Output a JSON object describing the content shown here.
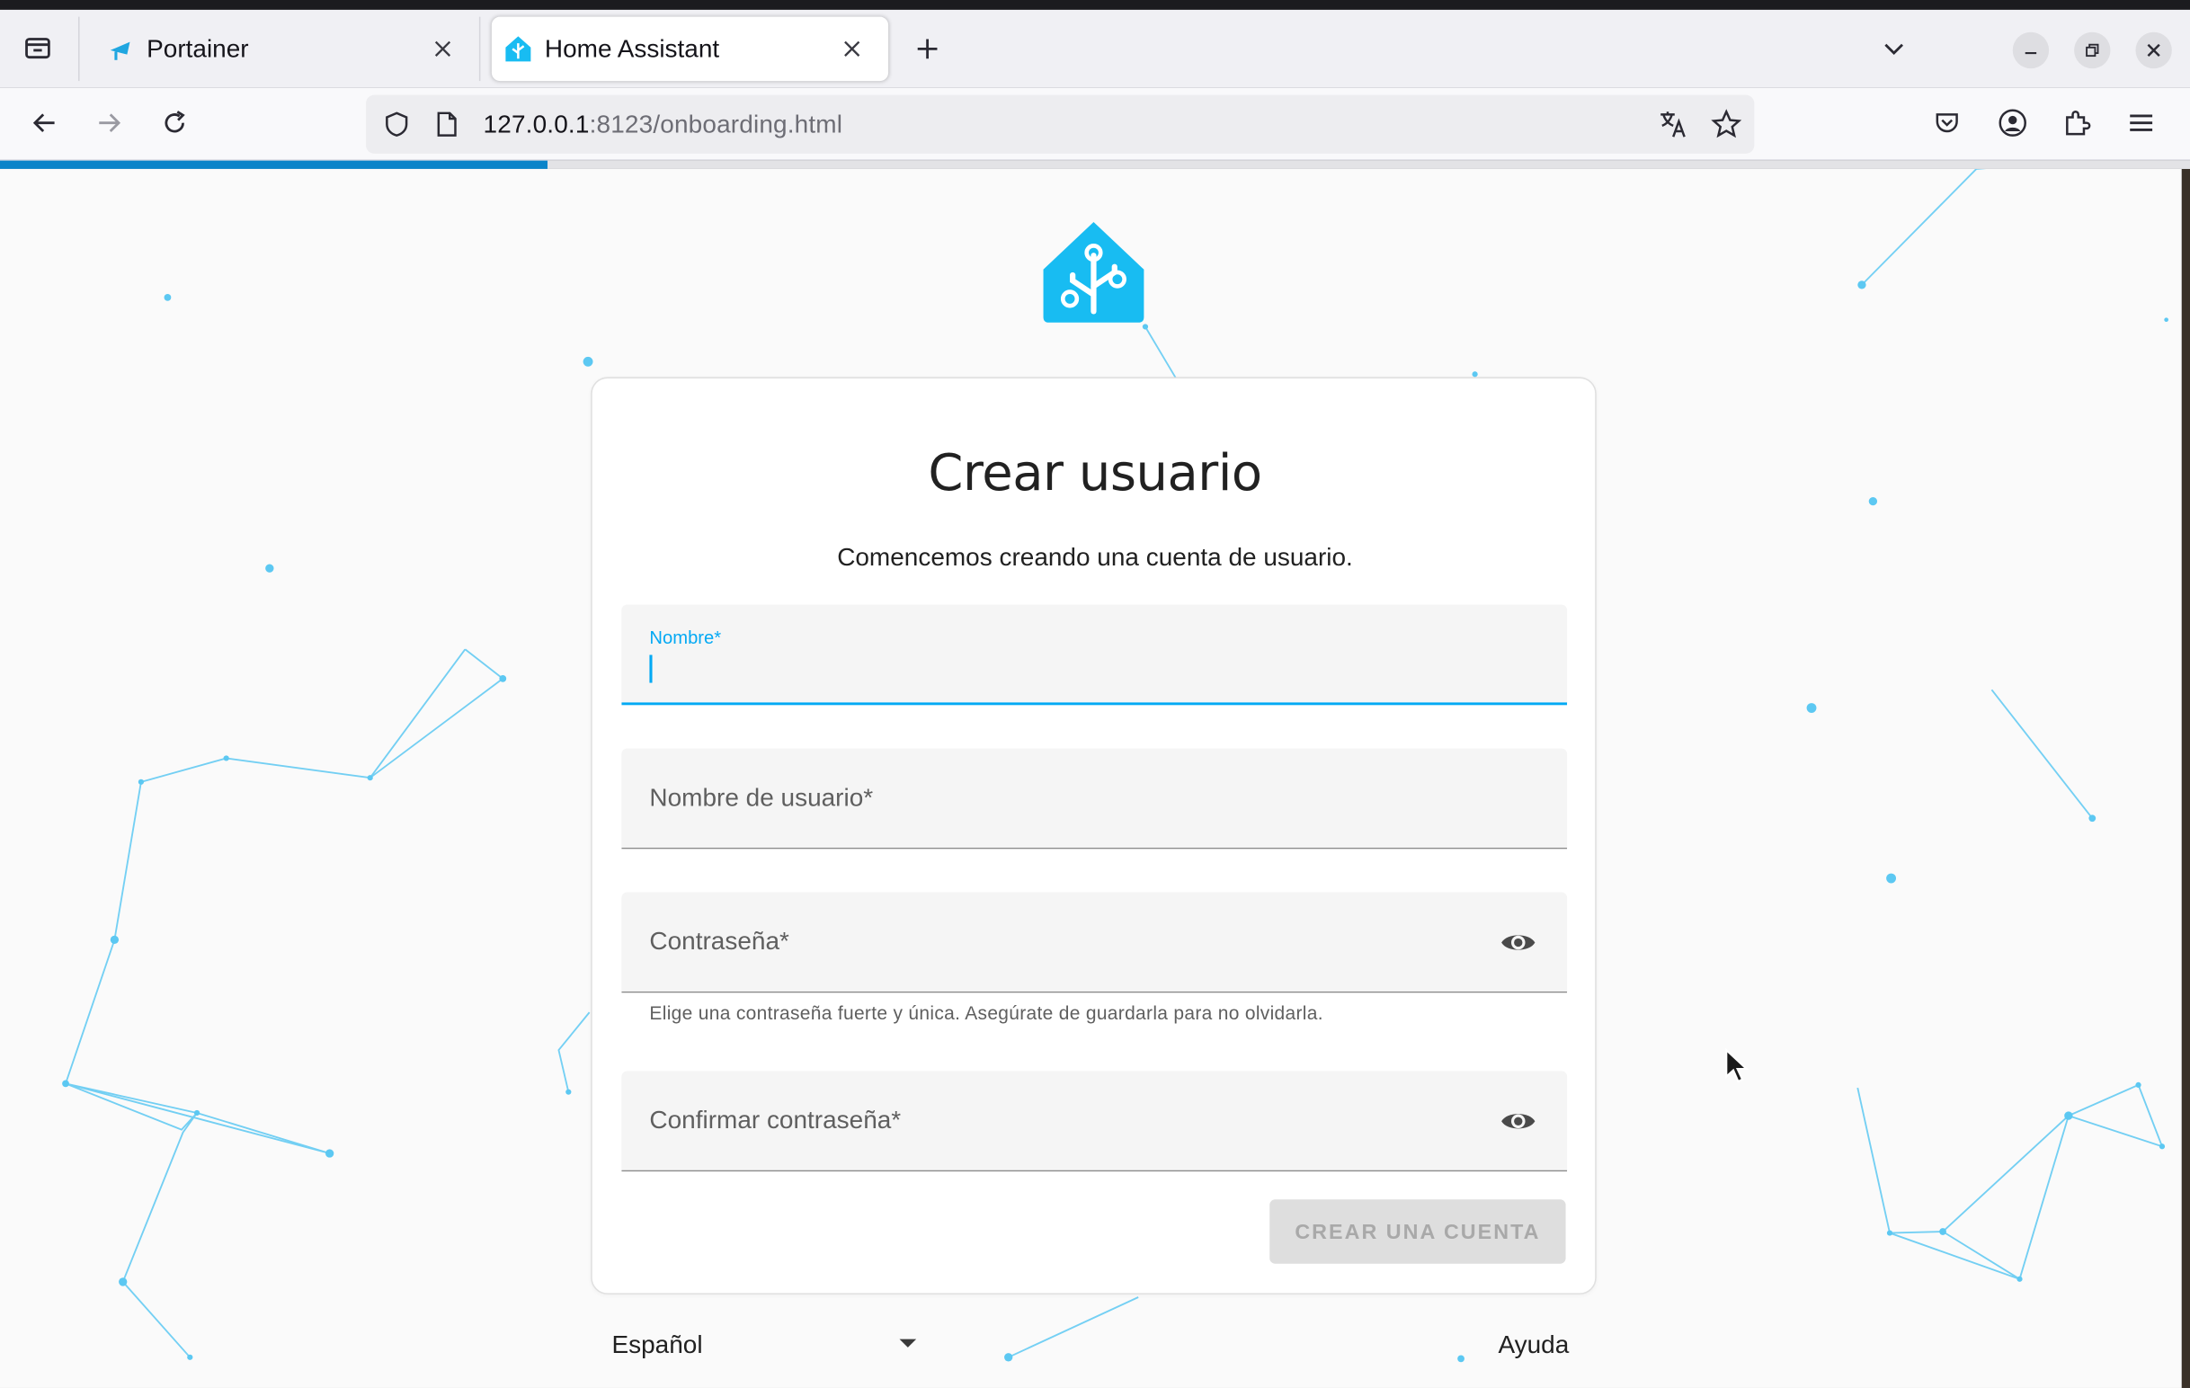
{
  "browser": {
    "tabs": [
      {
        "title": "Portainer",
        "active": false
      },
      {
        "title": "Home Assistant",
        "active": true
      }
    ],
    "url": {
      "host": "127.0.0.1",
      "rest": ":8123/onboarding.html"
    },
    "page_load_progress": 0.25
  },
  "page": {
    "title": "Crear usuario",
    "subtitle": "Comencemos creando una cuenta de usuario.",
    "fields": {
      "name": {
        "label": "Nombre*",
        "value": ""
      },
      "username": {
        "label": "Nombre de usuario*"
      },
      "password": {
        "label": "Contraseña*",
        "helper": "Elige una contraseña fuerte y única. Asegúrate de guardarla para no olvidarla."
      },
      "confirm": {
        "label": "Confirmar contraseña*"
      }
    },
    "submit_label": "CREAR UNA CUENTA",
    "language": "Español",
    "help_label": "Ayuda"
  },
  "colors": {
    "accent": "#03a9f4",
    "logo": "#18bcf2",
    "progress": "#0a84c9"
  }
}
